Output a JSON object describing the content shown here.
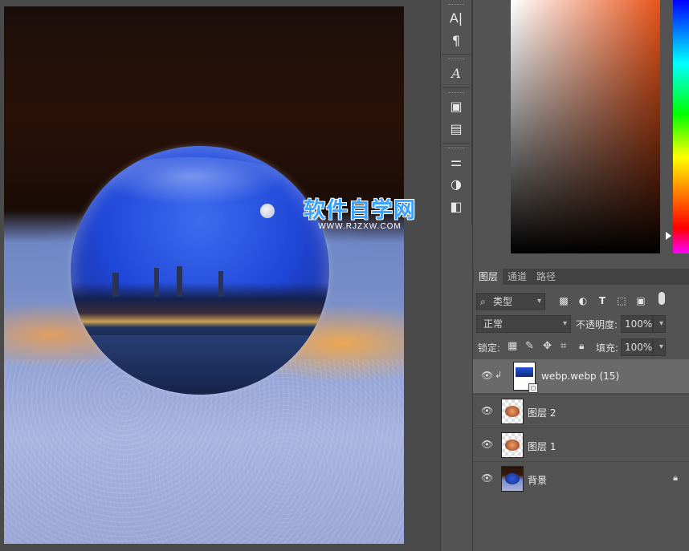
{
  "watermark": {
    "title": "软件自学网",
    "url": "WWW.RJZXW.COM"
  },
  "tools": {
    "character": "A|",
    "paragraph": "¶",
    "glyphs": "A",
    "properties": "▣",
    "notes": "▤",
    "adjustments": "⚌",
    "styles": "◑",
    "libraries": "◧"
  },
  "color_panel": {
    "hue_color": "#e8541a"
  },
  "layers_panel": {
    "tabs": [
      "图层",
      "通道",
      "路径"
    ],
    "filter": {
      "label": "类型"
    },
    "blend_mode": "正常",
    "opacity": {
      "label": "不透明度:",
      "value": "100%"
    },
    "lock": {
      "label": "锁定:"
    },
    "fill": {
      "label": "填充:",
      "value": "100%"
    },
    "layers": [
      {
        "name": "webp.webp (15)",
        "selected": true,
        "clipped": true
      },
      {
        "name": "图层 2",
        "selected": false
      },
      {
        "name": "图层 1",
        "selected": false
      },
      {
        "name": "背景",
        "selected": false,
        "locked": true
      }
    ]
  }
}
